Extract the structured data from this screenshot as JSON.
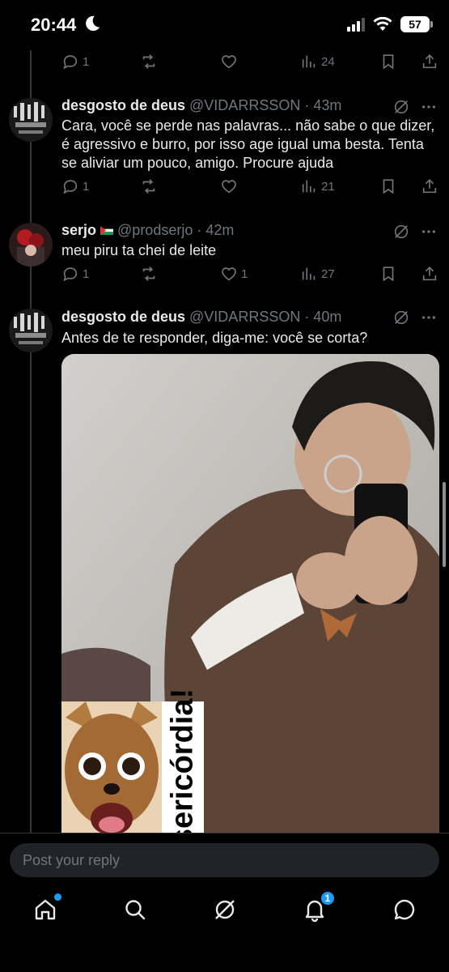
{
  "status": {
    "time": "20:44",
    "battery": "57"
  },
  "top_actions": {
    "replies": "1",
    "views": "24"
  },
  "tweets": [
    {
      "name": "desgosto de deus",
      "handle": "@VIDARRSSON",
      "time": "43m",
      "text": "Cara, você se perde nas palavras... não sabe o que dizer, é agressivo e burro, por isso age igual uma besta. Tenta se aliviar um pouco, amigo. Procure ajuda",
      "replies": "1",
      "views": "21"
    },
    {
      "name": "serjo",
      "handle": "@prodserjo",
      "time": "42m",
      "text": "meu piru ta chei de leite",
      "replies": "1",
      "likes": "1",
      "views": "27"
    },
    {
      "name": "desgosto de deus",
      "handle": "@VIDARRSSON",
      "time": "40m",
      "text": "Antes de te responder, diga-me: você se corta?",
      "media_sticker_text": "sericórdia!"
    }
  ],
  "reply": {
    "placeholder": "Post your reply"
  },
  "tabbar": {
    "notifications_count": "1"
  },
  "icons": [
    "reply-icon",
    "retweet-icon",
    "like-icon",
    "views-icon",
    "bookmark-icon",
    "share-icon",
    "grok-icon",
    "more-icon",
    "home-icon",
    "search-icon",
    "notifications-icon",
    "messages-icon"
  ],
  "colors": {
    "background": "#000000",
    "text": "#e7e9ea",
    "muted": "#71767b",
    "accent": "#1d9bf0"
  }
}
